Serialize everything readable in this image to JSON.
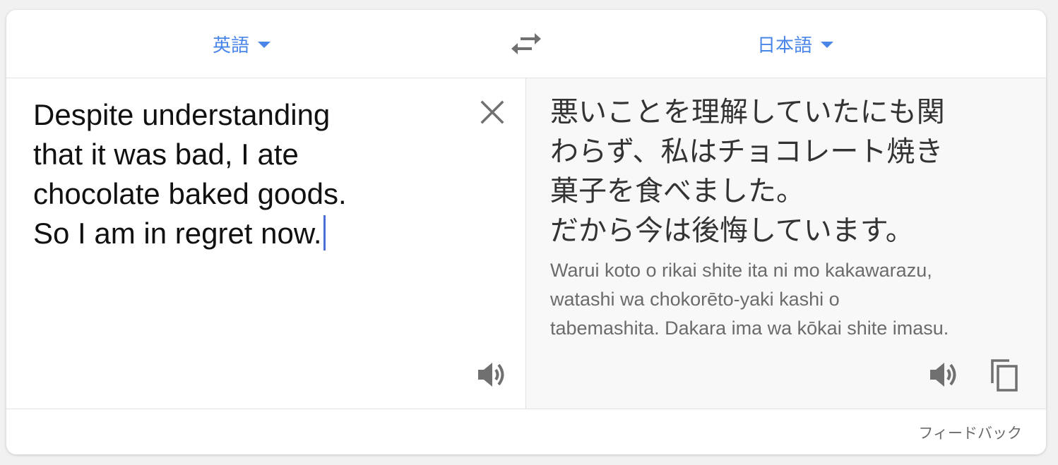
{
  "languages": {
    "source": "英語",
    "target": "日本語"
  },
  "source_text": "Despite understanding\nthat it was bad, I ate\nchocolate baked goods.\nSo I am in regret now.",
  "translation": {
    "text": "悪いことを理解していたにも関\nわらず、私はチョコレート焼き\n菓子を食べました。\nだから今は後悔しています。",
    "transliteration": "Warui koto o rikai shite ita ni mo kakawarazu,\nwatashi wa chokorēto-yaki kashi o\ntabemashita. Dakara ima wa kōkai shite imasu."
  },
  "footer": {
    "feedback": "フィードバック"
  },
  "icons": {
    "swap": "swap-arrows-icon",
    "clear": "close-icon",
    "speaker": "speaker-icon",
    "copy": "copy-icon",
    "dropdown": "caret-down-icon"
  },
  "colors": {
    "accent": "#4a86e8",
    "cursor": "#4a6fd8",
    "icon": "#707070"
  }
}
